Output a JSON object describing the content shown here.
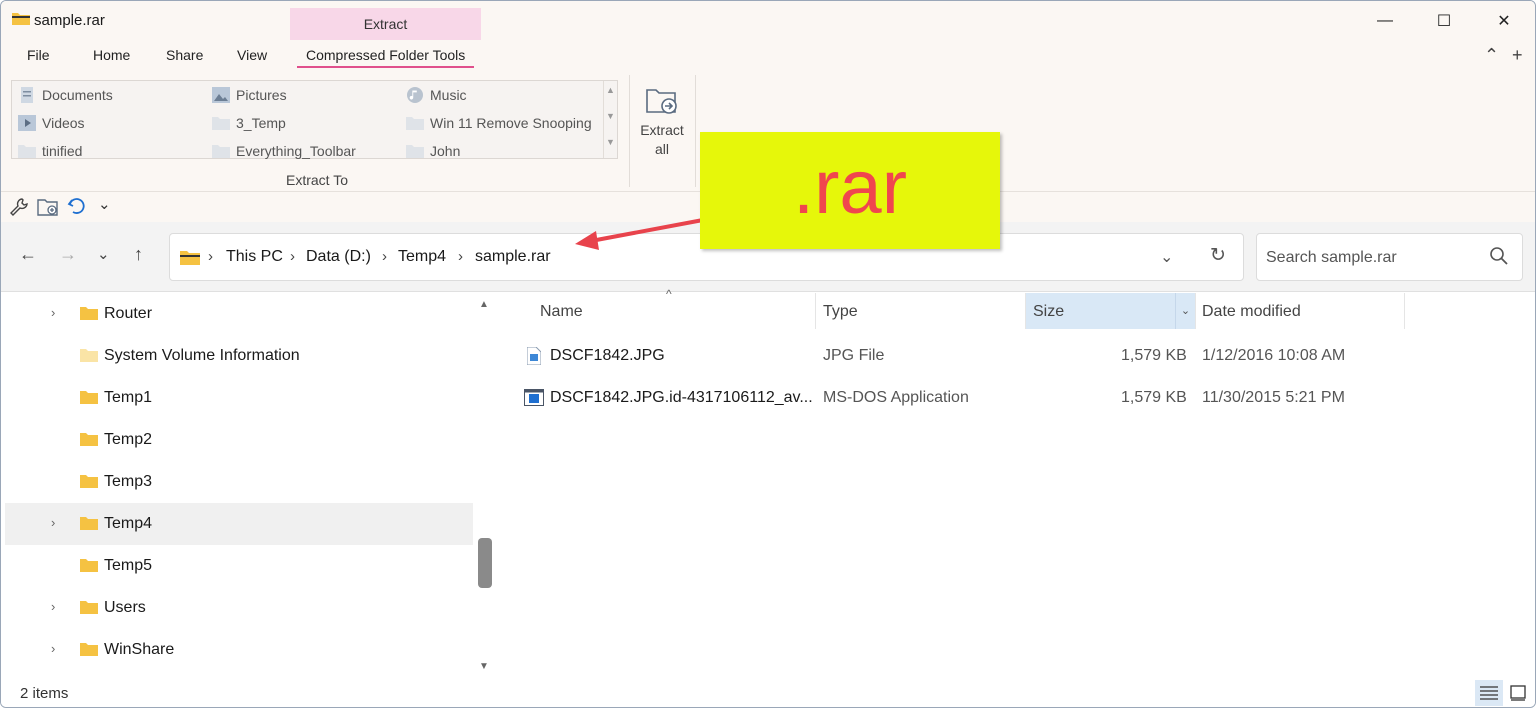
{
  "window": {
    "title": "sample.rar",
    "context_tab": "Extract",
    "minimize": "—",
    "maximize": "☐",
    "close": "✕"
  },
  "ribbon_tabs": [
    "File",
    "Home",
    "Share",
    "View",
    "Compressed Folder Tools"
  ],
  "ribbon_controls": {
    "collapse": "⌃",
    "help": "+"
  },
  "extract_to": {
    "items": [
      {
        "label": "Documents",
        "icon": "documents-icon"
      },
      {
        "label": "Pictures",
        "icon": "pictures-icon"
      },
      {
        "label": "Music",
        "icon": "music-icon"
      },
      {
        "label": "Videos",
        "icon": "videos-icon"
      },
      {
        "label": "3_Temp",
        "icon": "folder-icon"
      },
      {
        "label": "Win 11 Remove Snooping",
        "icon": "folder-icon"
      },
      {
        "label": "tinified",
        "icon": "folder-icon"
      },
      {
        "label": "Everything_Toolbar",
        "icon": "folder-icon"
      },
      {
        "label": "John",
        "icon": "folder-icon"
      }
    ],
    "group_label": "Extract To"
  },
  "extract_all": {
    "line1": "Extract",
    "line2": "all"
  },
  "quick_access": {
    "dropdown": "⌄"
  },
  "nav": {
    "back": "←",
    "forward": "→",
    "recent": "⌄",
    "up": "↑"
  },
  "breadcrumb": [
    "This PC",
    "Data (D:)",
    "Temp4",
    "sample.rar"
  ],
  "address_controls": {
    "dropdown": "⌄",
    "refresh": "↻"
  },
  "search": {
    "placeholder": "Search sample.rar"
  },
  "callout": {
    "text": ".rar",
    "color": "#f0464e",
    "background": "#e6f70a"
  },
  "tree": [
    {
      "label": "Router",
      "expandable": true,
      "selected": false
    },
    {
      "label": "System Volume Information",
      "expandable": false,
      "selected": false
    },
    {
      "label": "Temp1",
      "expandable": false,
      "selected": false
    },
    {
      "label": "Temp2",
      "expandable": false,
      "selected": false
    },
    {
      "label": "Temp3",
      "expandable": false,
      "selected": false
    },
    {
      "label": "Temp4",
      "expandable": true,
      "selected": true
    },
    {
      "label": "Temp5",
      "expandable": false,
      "selected": false
    },
    {
      "label": "Users",
      "expandable": true,
      "selected": false
    },
    {
      "label": "WinShare",
      "expandable": true,
      "selected": false
    }
  ],
  "columns": {
    "name": "Name",
    "type": "Type",
    "size": "Size",
    "date": "Date modified"
  },
  "files": [
    {
      "name": "DSCF1842.JPG",
      "type": "JPG File",
      "size": "1,579 KB",
      "date": "1/12/2016 10:08 AM",
      "icon": "image-file-icon"
    },
    {
      "name": "DSCF1842.JPG.id-4317106112_av...",
      "type": "MS-DOS Application",
      "size": "1,579 KB",
      "date": "11/30/2015 5:21 PM",
      "icon": "application-file-icon"
    }
  ],
  "status": {
    "item_count": "2 items"
  },
  "colors": {
    "accent": "#e0508c",
    "context_tab": "#f8d7e8",
    "folder": "#f5c242"
  }
}
